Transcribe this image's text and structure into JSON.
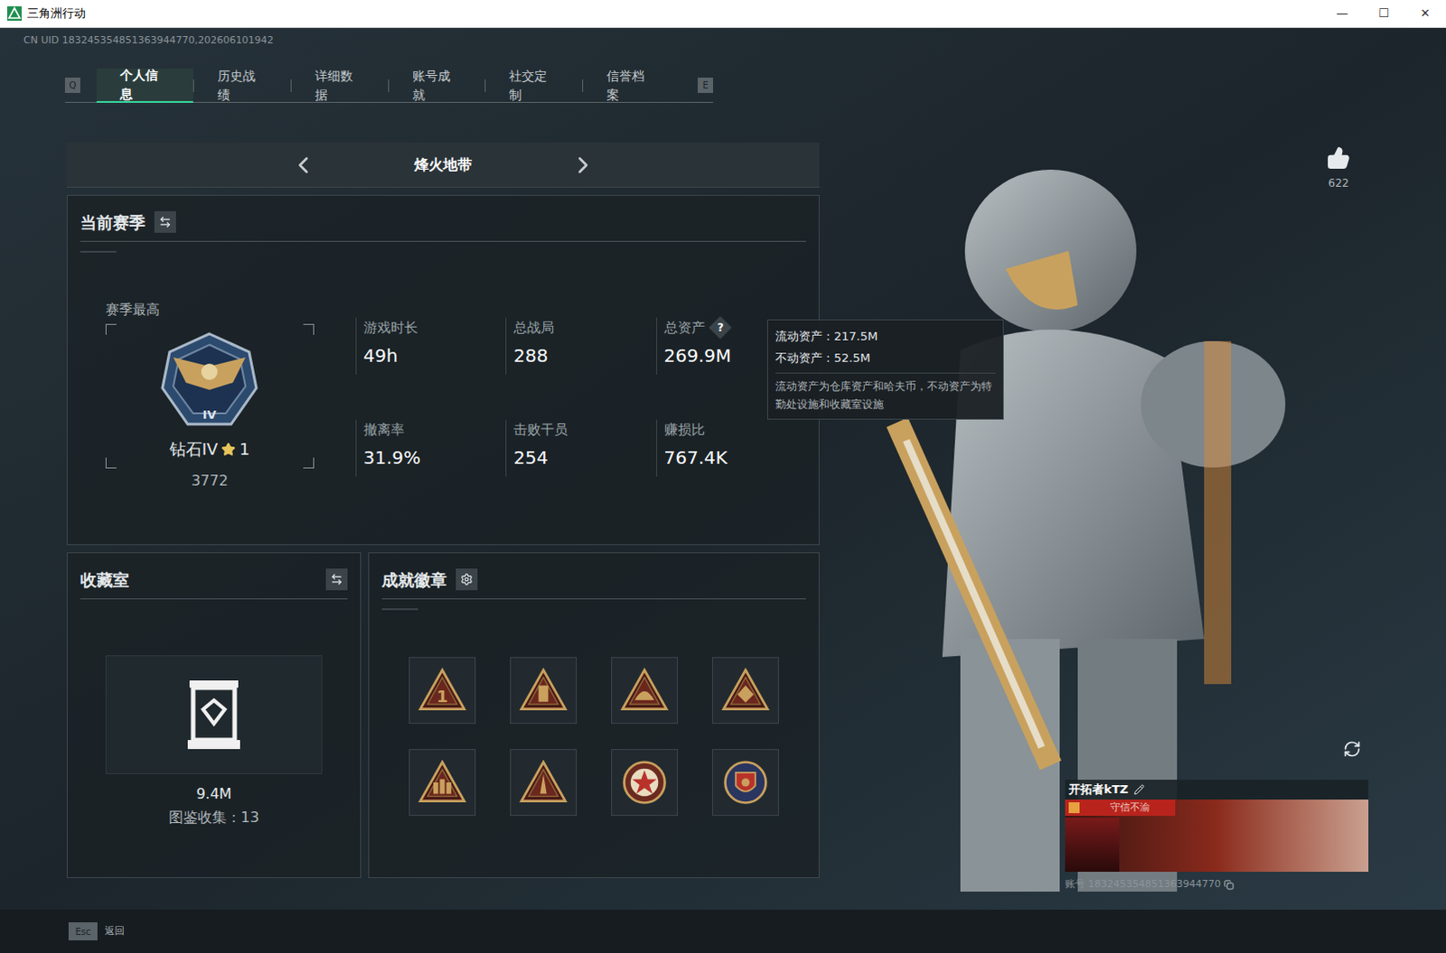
{
  "window": {
    "title": "三角洲行动",
    "controls": [
      "—",
      "☐",
      "✕"
    ]
  },
  "uid": "CN UID 183245354851363944770,202606101942",
  "tabs": {
    "prev_key": "Q",
    "next_key": "E",
    "items": [
      {
        "label": "个人信息",
        "selected": true
      },
      {
        "label": "历史战绩",
        "selected": false
      },
      {
        "label": "详细数据",
        "selected": false
      },
      {
        "label": "账号成就",
        "selected": false
      },
      {
        "label": "社交定制",
        "selected": false
      },
      {
        "label": "信誉档案",
        "selected": false
      }
    ]
  },
  "mode": {
    "label": "烽火地带"
  },
  "season": {
    "title": "当前赛季",
    "best_label": "赛季最高",
    "rank": {
      "name": "钻石IV",
      "numeral": "IV",
      "stars": "1",
      "score": "3772"
    },
    "stats": [
      {
        "label": "游戏时长",
        "value": "49h",
        "help": ""
      },
      {
        "label": "总战局",
        "value": "288",
        "help": ""
      },
      {
        "label": "总资产",
        "value": "269.9M",
        "help": "?"
      },
      {
        "label": "撤离率",
        "value": "31.9%",
        "help": ""
      },
      {
        "label": "击败干员",
        "value": "254",
        "help": ""
      },
      {
        "label": "赚损比",
        "value": "767.4K",
        "help": ""
      }
    ]
  },
  "tooltip": {
    "lines": [
      "流动资产：217.5M",
      "不动资产：52.5M"
    ],
    "note": "流动资产为仓库资产和哈夫币，不动资产为特勤处设施和收藏室设施"
  },
  "collection": {
    "title": "收藏室",
    "value": "9.4M",
    "caption": "图鉴收集：13"
  },
  "badges": {
    "title": "成就徽章",
    "items": [
      {
        "kind": "number",
        "text": "1"
      },
      {
        "kind": "tower",
        "text": ""
      },
      {
        "kind": "dome",
        "text": ""
      },
      {
        "kind": "eye",
        "text": ""
      },
      {
        "kind": "soldiers",
        "text": ""
      },
      {
        "kind": "rocket",
        "text": ""
      },
      {
        "kind": "star",
        "text": ""
      },
      {
        "kind": "shield",
        "text": ""
      }
    ]
  },
  "likes": {
    "count": "622"
  },
  "player": {
    "name": "开拓者kTZ",
    "title": "守信不渝",
    "account": "账号 183245354851363944770"
  },
  "footer": {
    "key": "Esc",
    "label": "返回"
  }
}
